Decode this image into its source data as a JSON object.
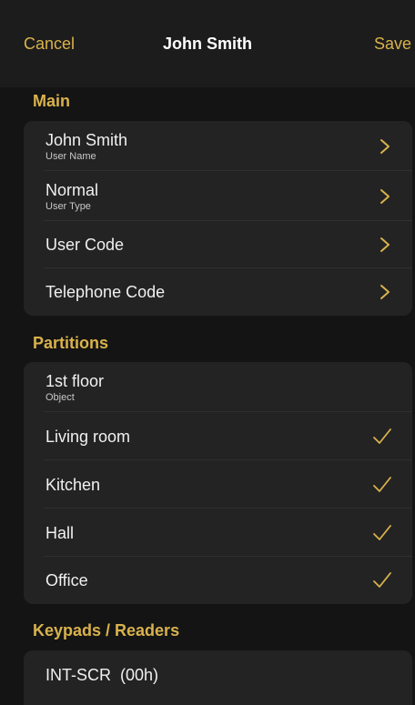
{
  "nav": {
    "cancel_label": "Cancel",
    "title": "John Smith",
    "save_label": "Save"
  },
  "colors": {
    "accent": "#d9b24c",
    "background": "#141414",
    "card": "#232323"
  },
  "sections": {
    "main": {
      "title": "Main",
      "rows": [
        {
          "label": "John Smith",
          "sublabel": "User Name",
          "icon": "chevron-right-icon"
        },
        {
          "label": "Normal",
          "sublabel": "User Type",
          "icon": "chevron-right-icon"
        },
        {
          "label": "User Code",
          "icon": "chevron-right-icon"
        },
        {
          "label": "Telephone Code",
          "icon": "chevron-right-icon"
        }
      ]
    },
    "partitions": {
      "title": "Partitions",
      "rows": [
        {
          "label": "1st floor",
          "sublabel": "Object"
        },
        {
          "label": "Living room",
          "checked": true,
          "icon": "checkmark-icon"
        },
        {
          "label": "Kitchen",
          "checked": true,
          "icon": "checkmark-icon"
        },
        {
          "label": "Hall",
          "checked": true,
          "icon": "checkmark-icon"
        },
        {
          "label": "Office",
          "checked": true,
          "icon": "checkmark-icon"
        }
      ]
    },
    "keypads": {
      "title": "Keypads / Readers",
      "rows": [
        {
          "label": "INT-SCR  (00h)"
        }
      ]
    }
  }
}
